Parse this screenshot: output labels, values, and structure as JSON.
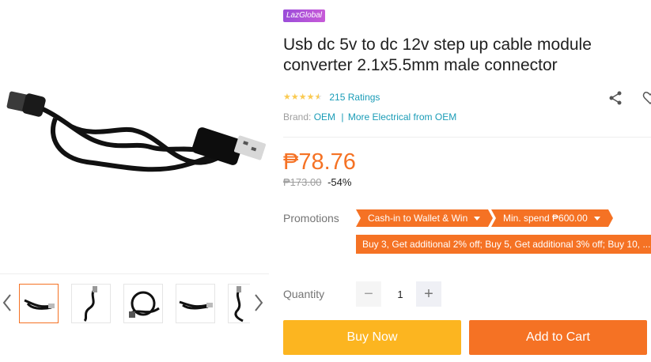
{
  "product": {
    "badge": "LazGlobal",
    "title": "Usb dc 5v to dc 12v step up cable module converter 2.1x5.5mm male connector",
    "rating": {
      "stars": 4.5,
      "count_label": "215 Ratings"
    },
    "brand": {
      "label": "Brand:",
      "name": "OEM",
      "more_link": "More Electrical from OEM"
    },
    "price": "₱78.76",
    "original_price": "₱173.00",
    "discount": "-54%"
  },
  "promotions": {
    "label": "Promotions",
    "tags": [
      "Cash-in to Wallet & Win",
      "Min. spend ₱600.00"
    ],
    "long_tag": "Buy 3, Get additional 2% off; Buy 5, Get additional 3% off; Buy 10, ..."
  },
  "quantity": {
    "label": "Quantity",
    "value": "1",
    "minus": "−",
    "plus": "+"
  },
  "actions": {
    "buy_now": "Buy Now",
    "add_to_cart": "Add to Cart"
  },
  "icons": {
    "share": "share-icon",
    "wishlist": "heart-icon",
    "prev": "chevron-left-icon",
    "next": "chevron-right-icon"
  },
  "colors": {
    "accent": "#f57224",
    "buy": "#fcb520",
    "link": "#1a9cb7",
    "star": "#faca51"
  }
}
